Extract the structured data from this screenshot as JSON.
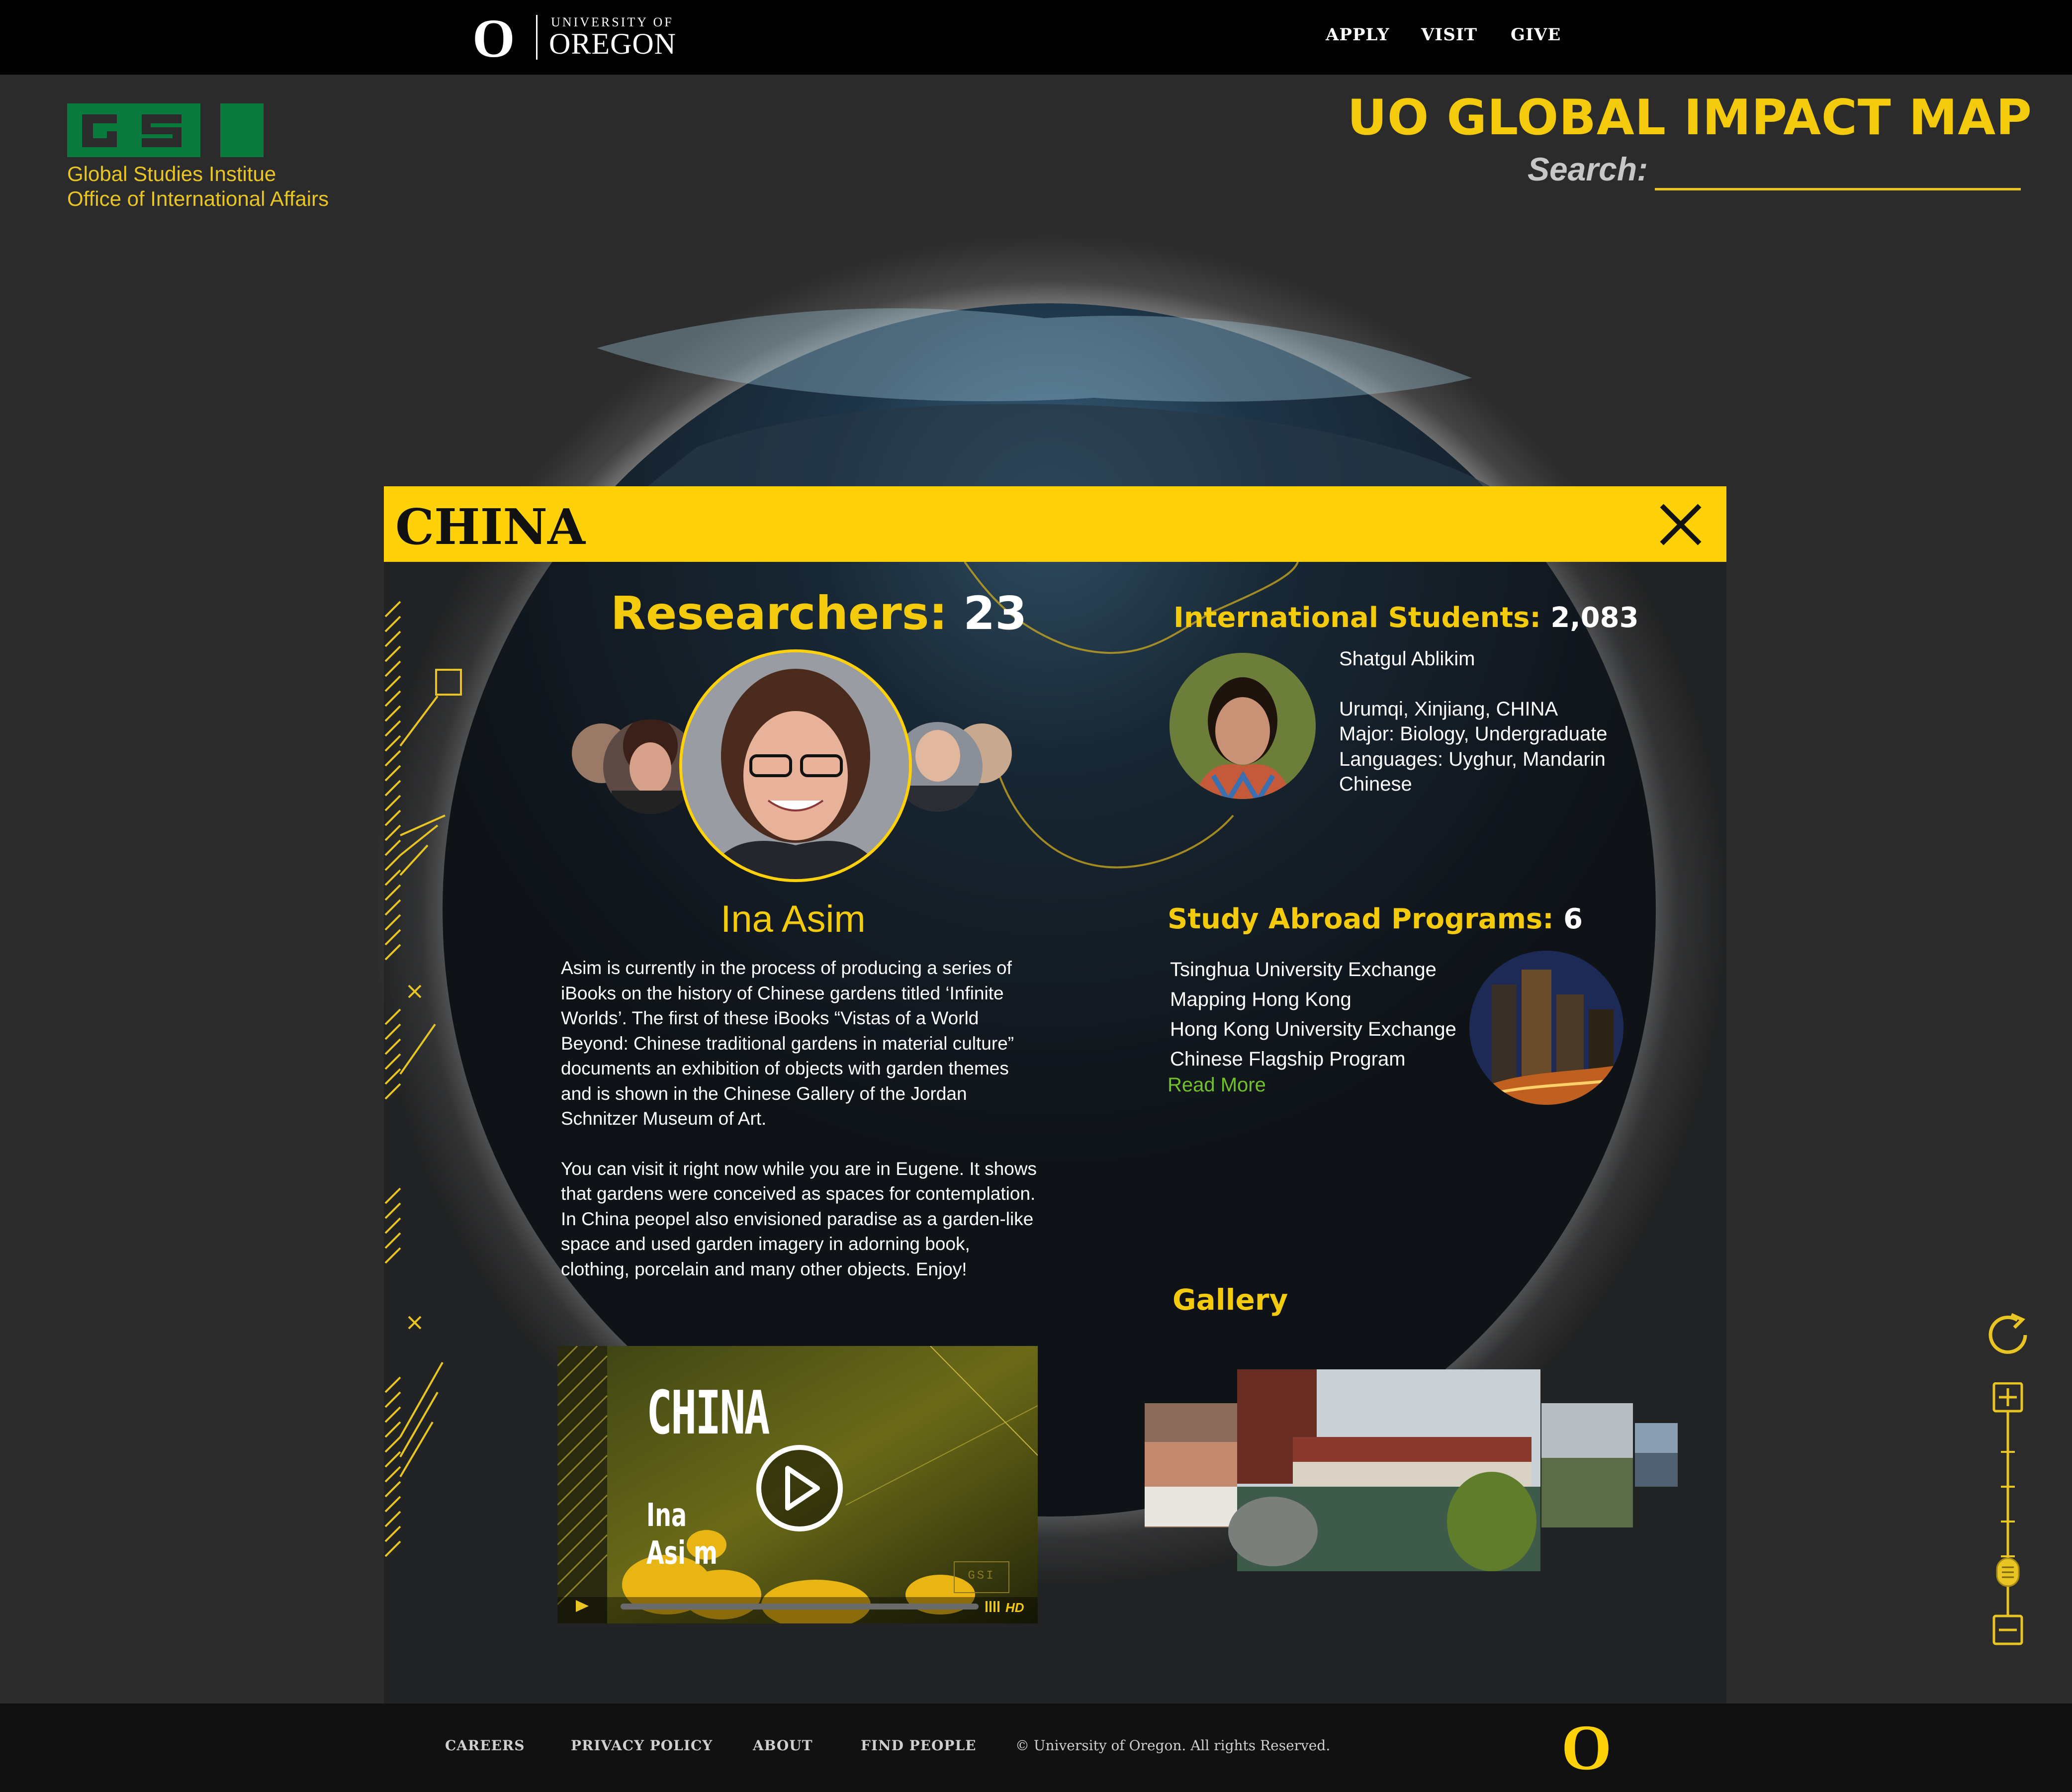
{
  "header": {
    "university_small": "UNIVERSITY OF",
    "university_big": "OREGON",
    "logo_letter": "O",
    "nav": [
      "APPLY",
      "VISIT",
      "GIVE"
    ]
  },
  "gsi": {
    "logo_text": "GSI",
    "line1": "Global Studies Institue",
    "line2": "Office of International Affairs"
  },
  "title": "UO GLOBAL IMPACT MAP",
  "search": {
    "label": "Search:",
    "value": ""
  },
  "panel": {
    "country": "CHINA",
    "researchers": {
      "label": "Researchers:",
      "count": "23",
      "featured_name": "Ina Asim",
      "bio": [
        "Asim is currently in the process of producing a series of iBooks on the history of Chinese gardens titled ‘Infinite Worlds’. The first of these iBooks “Vistas of a World Beyond: Chinese traditional gardens in material culture” documents an exhibition of objects with garden themes and is shown in the Chinese Gallery of the Jordan Schnitzer Museum of Art.",
        "You can visit it right now while you are in Eugene. It shows that gardens were conceived as spaces for contemplation. In China peopel also envisioned paradise as a garden-like space and used garden imagery in adorning book, clothing, porcelain and many other objects. Enjoy!"
      ]
    },
    "students": {
      "label": "International Students:",
      "count": "2,083",
      "name": "Shatgul Ablikim",
      "hometown": "Urumqi, Xinjiang, CHINA",
      "major": "Major: Biology, Undergraduate",
      "languages": "Languages: Uyghur, Mandarin Chinese"
    },
    "programs": {
      "label": "Study Abroad Programs:",
      "count": "6",
      "items": [
        "Tsinghua University Exchange",
        "Mapping Hong Kong",
        "Hong Kong University Exchange",
        "Chinese Flagship Program"
      ],
      "read_more": "Read More"
    },
    "gallery": {
      "label": "Gallery"
    },
    "video": {
      "title": "CHINA",
      "subtitle_line1": "Ina",
      "subtitle_line2": "Asi m",
      "badge": "GSI",
      "hd": "HD"
    }
  },
  "footer": {
    "links": [
      "CAREERS",
      "PRIVACY POLICY",
      "ABOUT",
      "FIND PEOPLE"
    ],
    "copyright": "© University of Oregon. All rights Reserved.",
    "logo_letter": "O"
  },
  "colors": {
    "accent_yellow": "#fed109",
    "gsi_green": "#0a7a3e",
    "read_more_green": "#72c02c",
    "background": "#2b2b2b"
  },
  "icons": [
    "close-icon",
    "refresh-icon",
    "zoom-in-icon",
    "zoom-out-icon",
    "play-icon"
  ]
}
